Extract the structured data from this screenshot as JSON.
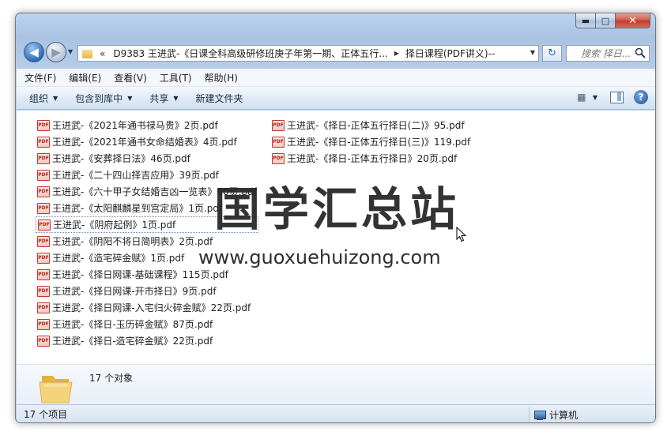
{
  "window": {
    "caption": {
      "minimize": "▬",
      "maximize": "□",
      "close": "✕"
    }
  },
  "nav": {
    "back_glyph": "◀",
    "forward_glyph": "▶",
    "history_glyph": "▼"
  },
  "address": {
    "overflow": "«",
    "segments": [
      "D9383 王进武-《日课全科高级研修班庚子年第一期、正体五行...",
      "择日课程(PDF讲义)--"
    ],
    "separator": "▶",
    "dropdown": "▼"
  },
  "refresh_glyph": "↻",
  "search": {
    "placeholder": "搜索 择日..."
  },
  "menu": [
    "文件(F)",
    "编辑(E)",
    "查看(V)",
    "工具(T)",
    "帮助(H)"
  ],
  "commands": [
    {
      "label": "组织",
      "has_arrow": true
    },
    {
      "label": "包含到库中",
      "has_arrow": true
    },
    {
      "label": "共享",
      "has_arrow": true
    },
    {
      "label": "新建文件夹",
      "has_arrow": false
    }
  ],
  "command_arrow": "▼",
  "view_glyph": "▦",
  "help_glyph": "?",
  "pdf_label": "PDF",
  "files_col1": [
    "王进武-《2021年通书禄马贵》2页.pdf",
    "王进武-《2021年通书女命结婚表》4页.pdf",
    "王进武-《安葬择日法》46页.pdf",
    "王进武-《二十四山择吉应用》39页.pdf",
    "王进武-《六十甲子女结婚吉凶一览表》60页.pdf",
    "王进武-《太阳麒麟星到宫定局》1页.pdf",
    "王进武-《阴府起例》1页.pdf",
    "王进武-《阴阳不将日简明表》2页.pdf",
    "王进武-《造宅碎金赋》1页.pdf",
    "王进武-《择日网课-基础课程》115页.pdf",
    "王进武-《择日网课-开市择日》9页.pdf",
    "王进武-《择日网课-入宅归火碎金赋》22页.pdf",
    "王进武-《择日-玉历碎金赋》87页.pdf",
    "王进武-《择日-造宅碎金赋》22页.pdf"
  ],
  "files_col2": [
    "王进武-《择日-正体五行择日(二)》95.pdf",
    "王进武-《择日-正体五行择日(三)》119.pdf",
    "王进武-《择日-正体五行择日》20页.pdf"
  ],
  "focused_index": 6,
  "watermark": {
    "title": "国学汇总站",
    "url": "www.guoxuehuizong.com"
  },
  "details": {
    "count_text": "17 个对象"
  },
  "status": {
    "count_text": "17 个项目",
    "location": "计算机"
  },
  "colors": {
    "accent": "#2c6bb8",
    "pdf_red": "#c0392b",
    "folder": "#e4b949"
  }
}
